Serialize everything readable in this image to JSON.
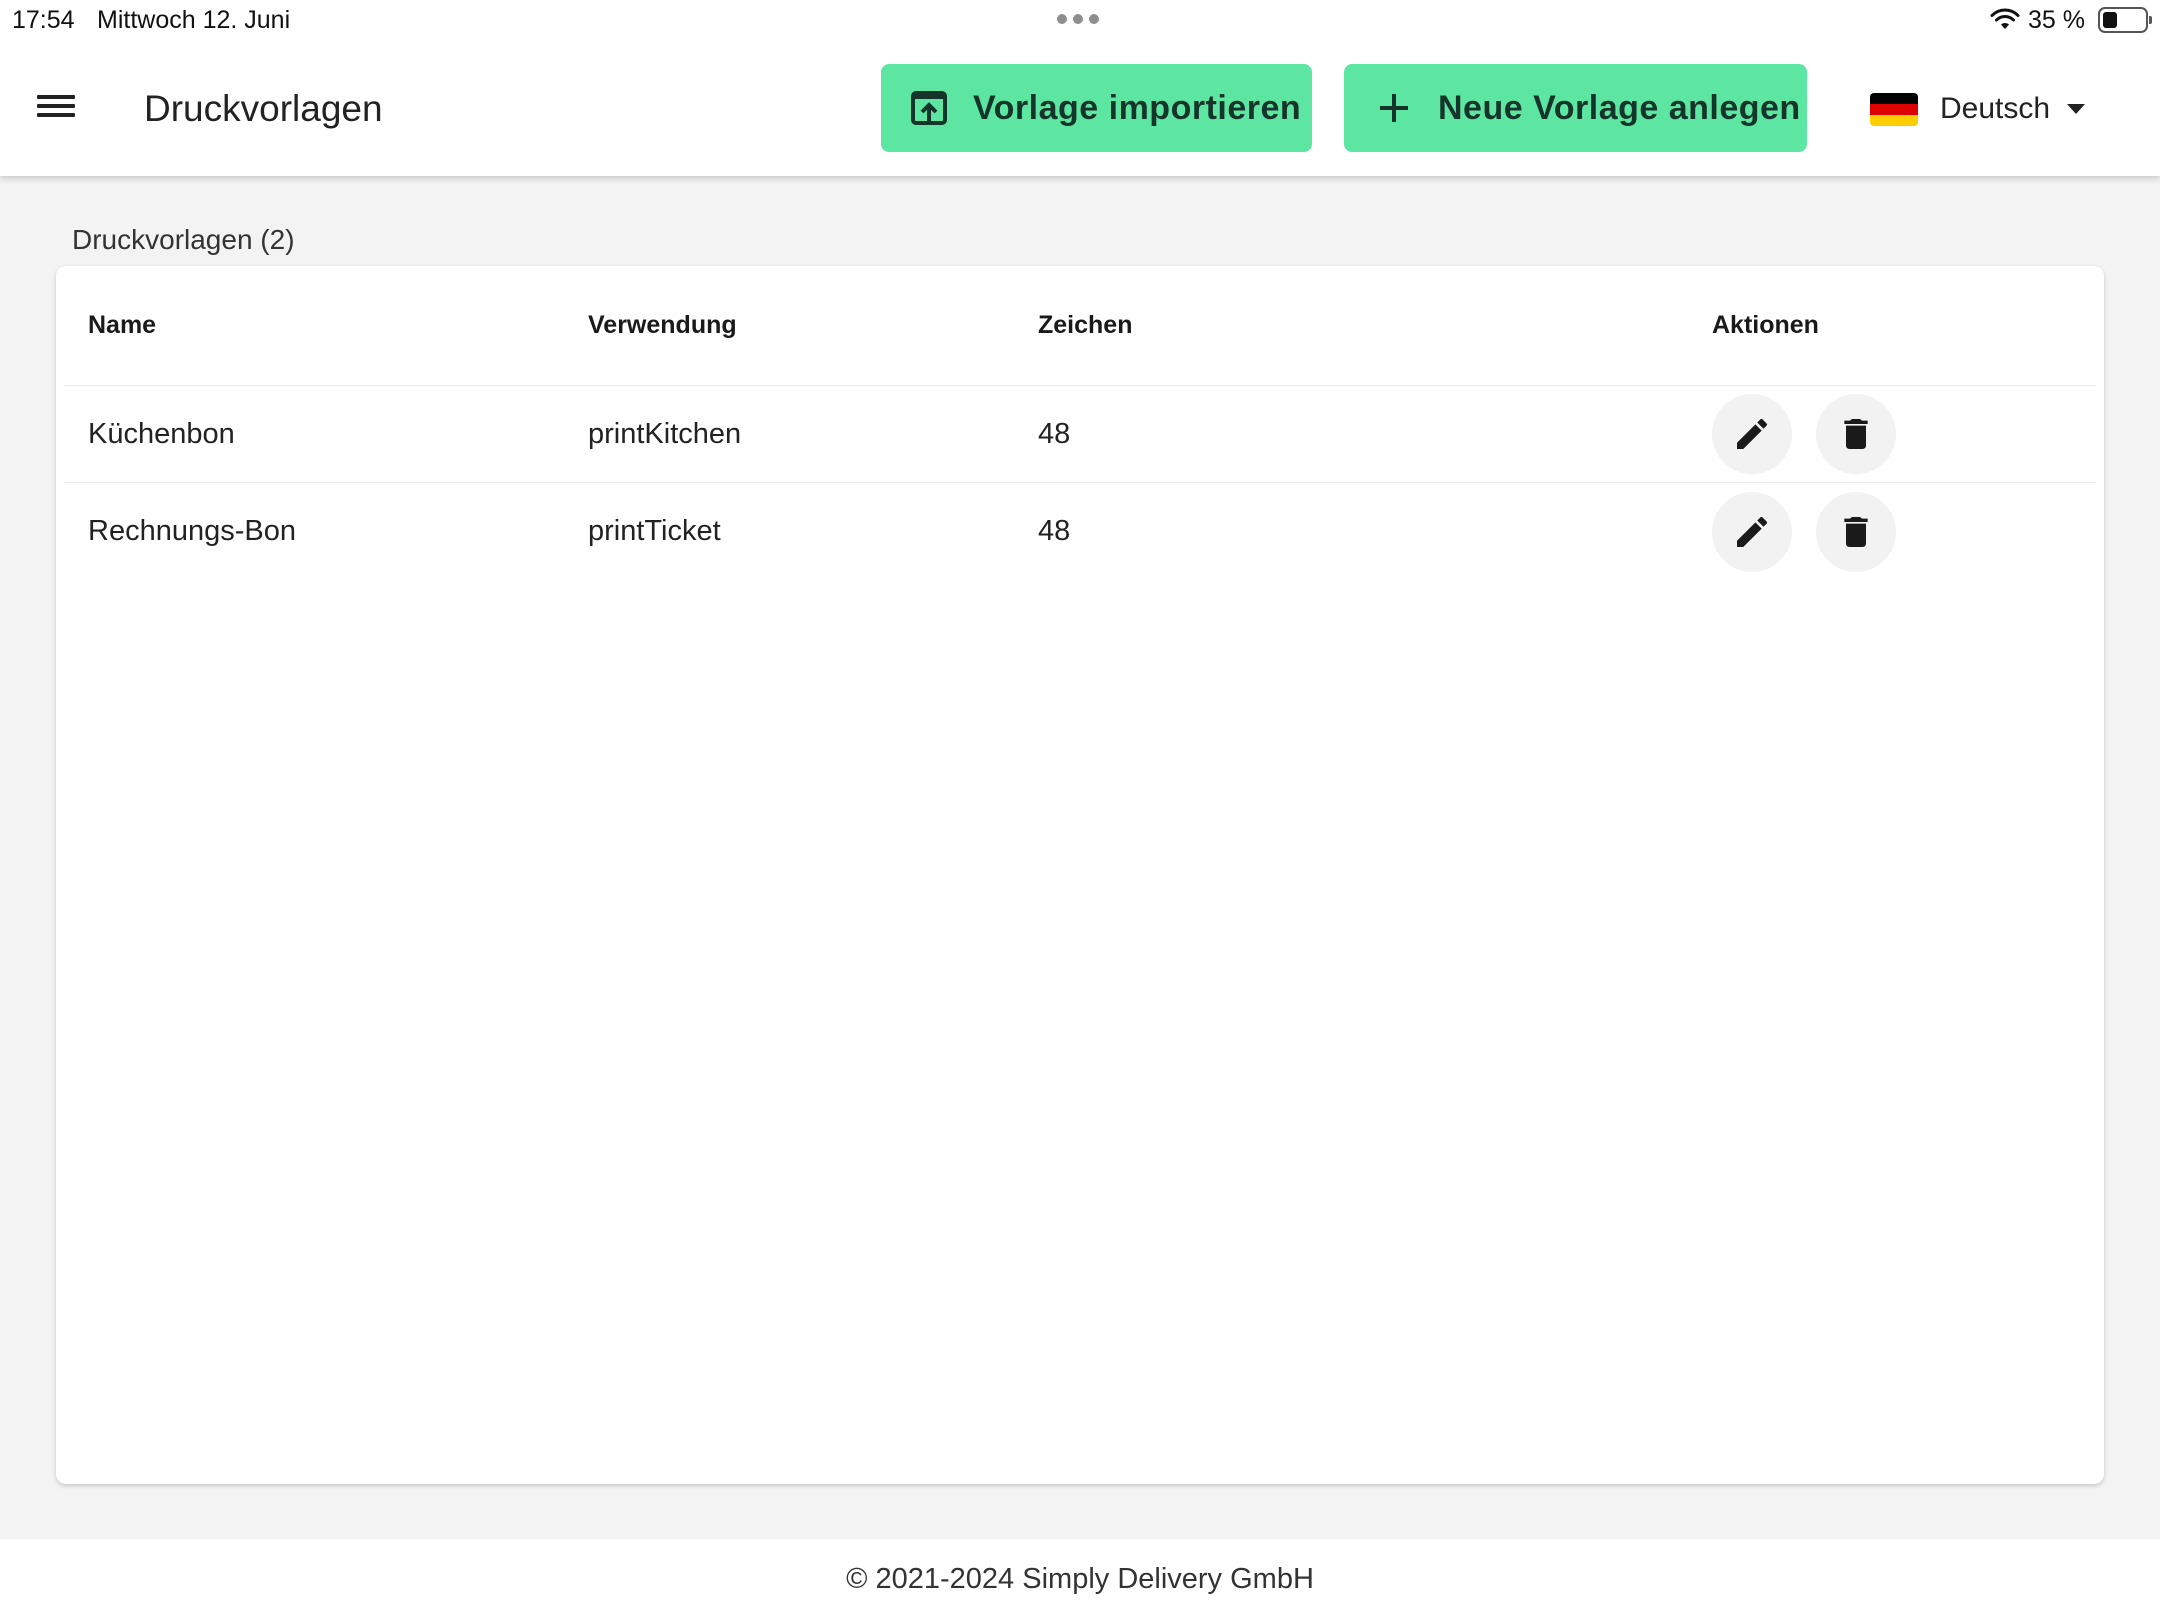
{
  "status_bar": {
    "time": "17:54",
    "date": "Mittwoch 12. Juni",
    "battery_percent": "35 %",
    "battery_level": 0.35
  },
  "header": {
    "title": "Druckvorlagen",
    "import_button": "Vorlage importieren",
    "new_button": "Neue Vorlage anlegen",
    "language": "Deutsch",
    "flag_colors": [
      "#000000",
      "#dd0000",
      "#ffce00"
    ],
    "accent_color": "#5ce6a1"
  },
  "main": {
    "section_title": "Druckvorlagen (2)",
    "table": {
      "columns": [
        "Name",
        "Verwendung",
        "Zeichen",
        "Aktionen"
      ],
      "rows": [
        {
          "name": "Küchenbon",
          "usage": "printKitchen",
          "chars": "48"
        },
        {
          "name": "Rechnungs-Bon",
          "usage": "printTicket",
          "chars": "48"
        }
      ],
      "row_actions": [
        "pencil-icon",
        "trash-icon"
      ]
    }
  },
  "footer": {
    "copyright": "© 2021-2024 Simply Delivery GmbH"
  }
}
